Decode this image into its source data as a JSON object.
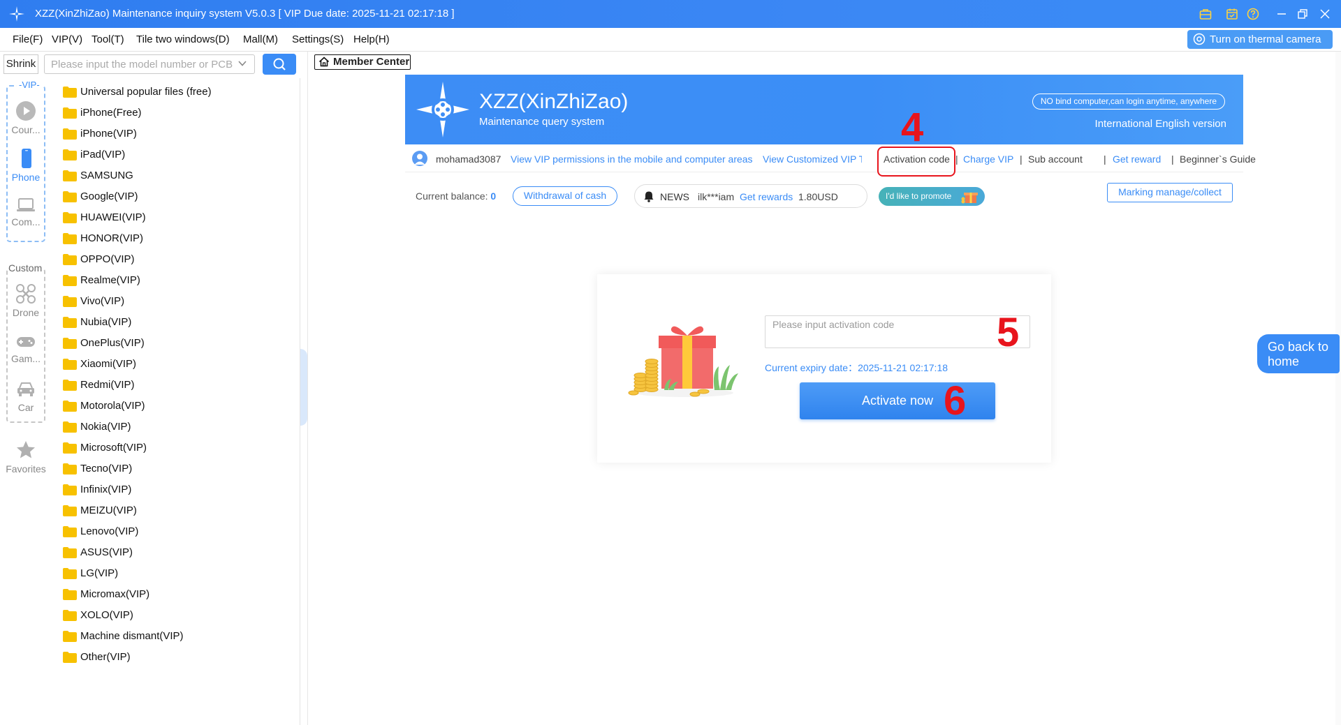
{
  "window": {
    "title": "XZZ(XinZhiZao) Maintenance inquiry system V5.0.3 [ VIP Due date: 2025-11-21 02:17:18 ]",
    "icons": [
      "briefcase-icon",
      "calendar-icon",
      "help-icon"
    ],
    "controls": [
      "minimize",
      "restore",
      "close"
    ]
  },
  "menubar": {
    "items": [
      "File(F)",
      "VIP(V)",
      "Tool(T)",
      "Tile two windows(D)",
      "Mall(M)",
      "Settings(S)",
      "Help(H)"
    ],
    "thermal_button": "Turn on thermal camera"
  },
  "search": {
    "shrink_label": "Shrink",
    "placeholder": "Please input the model number or PCB"
  },
  "leftnav": {
    "vip_tag": "VIP",
    "vip_items": [
      {
        "label": "Cour...",
        "icon": "play-circle-icon"
      },
      {
        "label": "Phone",
        "icon": "phone-icon",
        "active": true
      },
      {
        "label": "Com...",
        "icon": "laptop-icon"
      }
    ],
    "custom_tag": "Custom",
    "custom_items": [
      {
        "label": "Drone",
        "icon": "drone-icon"
      },
      {
        "label": "Gam...",
        "icon": "gamepad-icon"
      },
      {
        "label": "Car",
        "icon": "car-icon"
      }
    ],
    "favorites": {
      "label": "Favorites",
      "icon": "star-icon"
    }
  },
  "files": [
    "Universal popular files (free)",
    "iPhone(Free)",
    "iPhone(VIP)",
    "iPad(VIP)",
    "SAMSUNG",
    "Google(VIP)",
    "HUAWEI(VIP)",
    "HONOR(VIP)",
    "OPPO(VIP)",
    "Realme(VIP)",
    "Vivo(VIP)",
    "Nubia(VIP)",
    "OnePlus(VIP)",
    "Xiaomi(VIP)",
    "Redmi(VIP)",
    "Motorola(VIP)",
    "Nokia(VIP)",
    "Microsoft(VIP)",
    "Tecno(VIP)",
    "Infinix(VIP)",
    "MEIZU(VIP)",
    "Lenovo(VIP)",
    "ASUS(VIP)",
    "LG(VIP)",
    "Micromax(VIP)",
    "XOLO(VIP)",
    "Machine dismant(VIP)",
    "Other(VIP)"
  ],
  "tab": {
    "label": "Member Center"
  },
  "banner": {
    "name": "XZZ(XinZhiZao)",
    "subtitle": "Maintenance query system",
    "pill": "NO bind computer,can login anytime, anywhere",
    "lang": "International English version"
  },
  "links": {
    "username": "mohamad3087",
    "vip_permissions": "View VIP permissions in the mobile and computer areas",
    "customized_vip": "View Customized VIP Time",
    "activation_code": "Activation code",
    "sep": "|",
    "charge_vip": "Charge VIP",
    "sub_account": "Sub account",
    "get_reward": "Get reward",
    "beginners_guide": "Beginner`s Guide"
  },
  "balance": {
    "label": "Current balance:",
    "value": "0",
    "withdraw": "Withdrawal of cash",
    "news_label": "NEWS",
    "news_user": "ilk***iam",
    "news_action": "Get rewards",
    "news_amount": "1.80USD",
    "promote": "I'd like to promote",
    "marking": "Marking manage/collect"
  },
  "activation": {
    "placeholder": "Please input activation code",
    "expiry_label": "Current expiry date：",
    "expiry_value": "2025-11-21 02:17:18",
    "button": "Activate now"
  },
  "annotations": {
    "a4": "4",
    "a5": "5",
    "a6": "6"
  },
  "goback": {
    "line1": "Go back to",
    "line2": "home"
  },
  "colors": {
    "accent": "#3a8cf6",
    "annotation": "#e8141c",
    "folder": "#f7c100"
  }
}
